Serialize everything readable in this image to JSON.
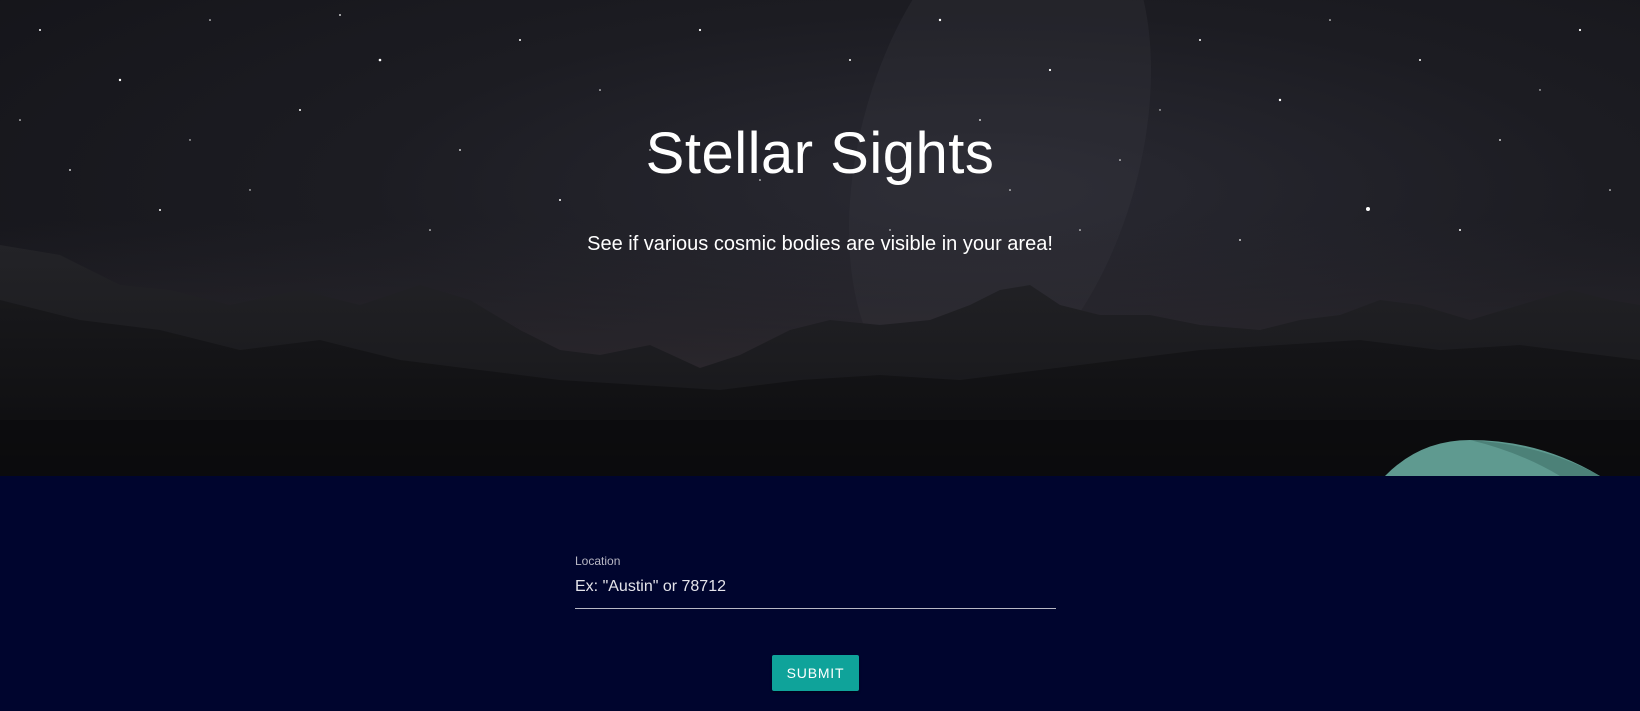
{
  "hero": {
    "title": "Stellar Sights",
    "subtitle": "See if various cosmic bodies are visible in your area!"
  },
  "form": {
    "location_label": "Location",
    "location_placeholder": "Ex: \"Austin\" or 78712",
    "location_value": "",
    "submit_label": "SUBMIT"
  },
  "colors": {
    "background": "#00052e",
    "accent": "#0fa39a"
  }
}
